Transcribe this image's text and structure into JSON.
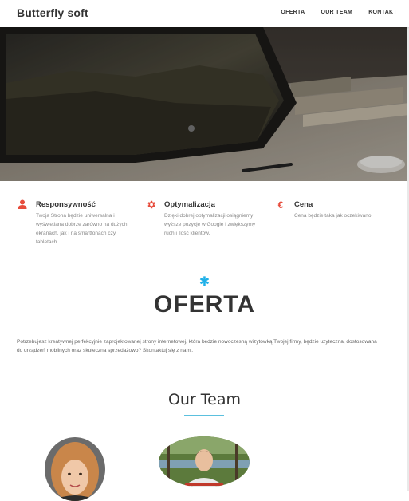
{
  "header": {
    "brand": "Butterfly soft",
    "nav": [
      "OFERTA",
      "OUR TEAM",
      "KONTAKT"
    ]
  },
  "features": [
    {
      "icon": "user-icon",
      "title": "Responsywność",
      "desc": "Twoja Strona będzie uniwersalna i wyświetlana dobrze zarówno na dużych ekranach, jak i na smartfonach czy tabletach."
    },
    {
      "icon": "gear-icon",
      "title": "Optymalizacja",
      "desc": "Dzięki dobrej optymalizacji osiągniemy wyższe pozycje w Google i zwiększymy ruch i ilość klientów."
    },
    {
      "icon": "euro-icon",
      "title": "Cena",
      "desc": "Cena będzie taka jak oczekiwano."
    }
  ],
  "oferta": {
    "title": "OFERTA",
    "text": "Potrzebujesz kreatywnej perfekcyjnie zaprojektowanej strony internetowej, która będzie nowoczesną wizytówką Twojej firmy, będzie użyteczna, dostosowana do urządzeń mobilnych oraz skuteczna sprzedażowo? Skontaktuj się z nami."
  },
  "team": {
    "title": "Our Team"
  },
  "colors": {
    "accent": "#e74c3c",
    "asterisk": "#1fb0e8",
    "underline": "#5bc0de"
  }
}
